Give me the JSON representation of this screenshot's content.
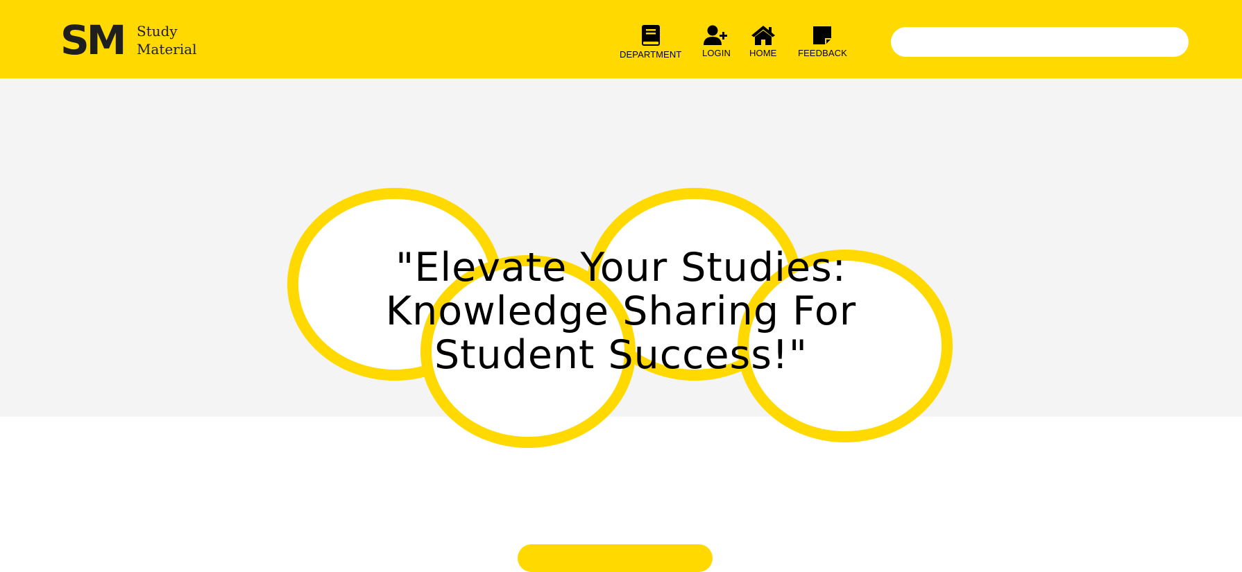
{
  "brand": {
    "initials": "SM",
    "name_line1": "Study",
    "name_line2": "Material"
  },
  "nav": {
    "department": {
      "label": "DEPARTMENT",
      "icon": "book-icon"
    },
    "login": {
      "label": "LOGIN",
      "icon": "user-plus-icon"
    },
    "home": {
      "label": "HOME",
      "icon": "home-icon"
    },
    "feedback": {
      "label": "FEEDBACK",
      "icon": "sticky-note-icon"
    }
  },
  "search": {
    "value": "",
    "placeholder": ""
  },
  "hero": {
    "title": "\"Elevate Your Studies: Knowledge Sharing For Student Success!\""
  },
  "colors": {
    "accent": "#FFD900",
    "hero_bg": "#F4F4F4",
    "text": "#000000"
  }
}
